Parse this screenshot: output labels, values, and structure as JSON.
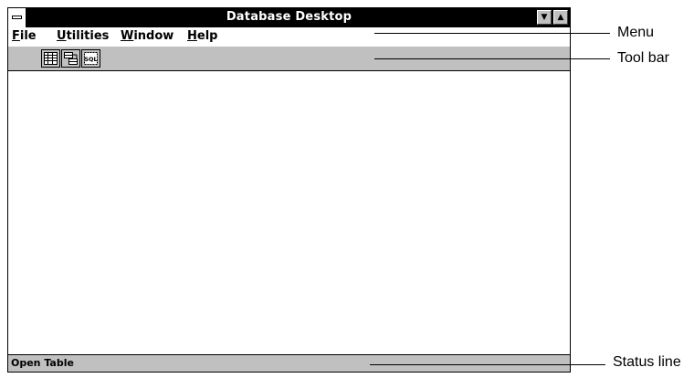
{
  "window": {
    "title": "Database Desktop"
  },
  "menu": {
    "items": [
      {
        "accel": "F",
        "rest": "ile"
      },
      {
        "accel": "U",
        "rest": "tilities"
      },
      {
        "accel": "W",
        "rest": "indow"
      },
      {
        "accel": "H",
        "rest": "elp"
      }
    ]
  },
  "toolbar": {
    "buttons": [
      {
        "icon": "open-table-icon"
      },
      {
        "icon": "open-query-icon"
      },
      {
        "icon": "open-sql-icon",
        "text": "SQL"
      }
    ]
  },
  "status": {
    "text": "Open Table"
  },
  "callouts": {
    "menu": "Menu",
    "toolbar": "Tool bar",
    "status": "Status line"
  }
}
